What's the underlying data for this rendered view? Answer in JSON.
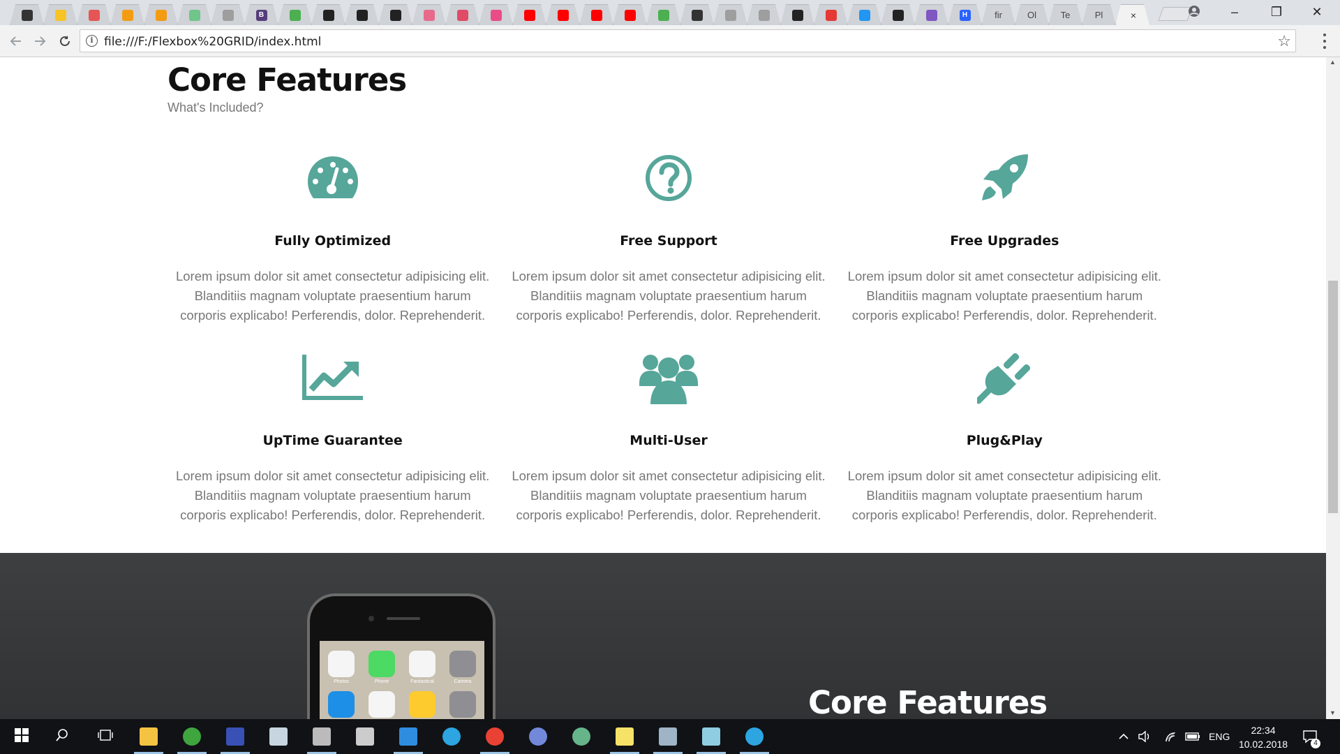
{
  "browser": {
    "tabs": [
      {
        "icon": "codepen-icon",
        "color": "#333333",
        "glyph": ""
      },
      {
        "icon": "sketch-icon",
        "color": "#f7c325",
        "glyph": ""
      },
      {
        "icon": "swirl-icon",
        "color": "#e65555",
        "glyph": ""
      },
      {
        "icon": "asterisk-icon",
        "color": "#f39c12",
        "glyph": ""
      },
      {
        "icon": "asterisk-icon",
        "color": "#f39c12",
        "glyph": ""
      },
      {
        "icon": "hexagon-icon",
        "color": "#6fc58a",
        "glyph": ""
      },
      {
        "icon": "page-icon",
        "color": "#9e9e9e",
        "glyph": ""
      },
      {
        "icon": "bootstrap-icon",
        "color": "#563d7c",
        "glyph": "B"
      },
      {
        "icon": "shield-icon",
        "color": "#4caf50",
        "glyph": ""
      },
      {
        "icon": "camera-icon",
        "color": "#222222",
        "glyph": ""
      },
      {
        "icon": "flag-icon",
        "color": "#222222",
        "glyph": ""
      },
      {
        "icon": "github-icon",
        "color": "#222222",
        "glyph": ""
      },
      {
        "icon": "script-icon",
        "color": "#e76a8a",
        "glyph": ""
      },
      {
        "icon": "u-logo-icon",
        "color": "#e04c66",
        "glyph": ""
      },
      {
        "icon": "dribbble-icon",
        "color": "#ea4c89",
        "glyph": ""
      },
      {
        "icon": "youtube-icon",
        "color": "#ff0000",
        "glyph": ""
      },
      {
        "icon": "youtube-icon",
        "color": "#ff0000",
        "glyph": ""
      },
      {
        "icon": "youtube-icon",
        "color": "#ff0000",
        "glyph": ""
      },
      {
        "icon": "youtube-icon",
        "color": "#ff0000",
        "glyph": ""
      },
      {
        "icon": "w3-icon",
        "color": "#4caf50",
        "glyph": ""
      },
      {
        "icon": "face-icon",
        "color": "#333333",
        "glyph": ""
      },
      {
        "icon": "page-icon",
        "color": "#9e9e9e",
        "glyph": ""
      },
      {
        "icon": "page-icon",
        "color": "#9e9e9e",
        "glyph": ""
      },
      {
        "icon": "github-icon",
        "color": "#222222",
        "glyph": ""
      },
      {
        "icon": "rss-icon",
        "color": "#e53935",
        "glyph": ""
      },
      {
        "icon": "mail-icon",
        "color": "#2196f3",
        "glyph": ""
      },
      {
        "icon": "slash-icon",
        "color": "#222222",
        "glyph": ""
      },
      {
        "icon": "colors-icon",
        "color": "#7e57c2",
        "glyph": ""
      },
      {
        "icon": "h-logo-icon",
        "color": "#2962ff",
        "glyph": "H"
      },
      {
        "icon": "text-tab-icon",
        "color": "",
        "glyph": "fir"
      },
      {
        "icon": "text-tab-icon",
        "color": "",
        "glyph": "Ol"
      },
      {
        "icon": "text-tab-icon",
        "color": "",
        "glyph": "Te"
      },
      {
        "icon": "text-tab-icon",
        "color": "",
        "glyph": "Pl"
      }
    ],
    "active_tab_close": "×",
    "window_buttons": {
      "minimize": "–",
      "restore": "❐",
      "close": "✕"
    },
    "url": "file:///F:/Flexbox%20GRID/index.html",
    "info_glyph": "i",
    "star_glyph": "☆"
  },
  "page": {
    "title": "Core Features",
    "subtitle": "What's Included?",
    "accent_color": "#56a69a",
    "features": [
      {
        "icon": "dashboard-icon",
        "title": "Fully Optimized",
        "text": "Lorem ipsum dolor sit amet consectetur adipisicing elit. Blanditiis magnam voluptate praesentium harum corporis explicabo! Perferendis, dolor. Reprehenderit."
      },
      {
        "icon": "question-circle-icon",
        "title": "Free Support",
        "text": "Lorem ipsum dolor sit amet consectetur adipisicing elit. Blanditiis magnam voluptate praesentium harum corporis explicabo! Perferendis, dolor. Reprehenderit."
      },
      {
        "icon": "rocket-icon",
        "title": "Free Upgrades",
        "text": "Lorem ipsum dolor sit amet consectetur adipisicing elit. Blanditiis magnam voluptate praesentium harum corporis explicabo! Perferendis, dolor. Reprehenderit."
      },
      {
        "icon": "line-chart-icon",
        "title": "UpTime Guarantee",
        "text": "Lorem ipsum dolor sit amet consectetur adipisicing elit. Blanditiis magnam voluptate praesentium harum corporis explicabo! Perferendis, dolor. Reprehenderit."
      },
      {
        "icon": "users-icon",
        "title": "Multi-User",
        "text": "Lorem ipsum dolor sit amet consectetur adipisicing elit. Blanditiis magnam voluptate praesentium harum corporis explicabo! Perferendis, dolor. Reprehenderit."
      },
      {
        "icon": "plug-icon",
        "title": "Plug&Play",
        "text": "Lorem ipsum dolor sit amet consectetur adipisicing elit. Blanditiis magnam voluptate praesentium harum corporis explicabo! Perferendis, dolor. Reprehenderit."
      }
    ],
    "dark_section": {
      "title": "Core Features",
      "phone_apps": [
        {
          "label": "Photos",
          "color": "#f5f5f5"
        },
        {
          "label": "Phone",
          "color": "#4cd964"
        },
        {
          "label": "Fantastical",
          "color": "#f5f5f5"
        },
        {
          "label": "Camera",
          "color": "#8e8e93"
        },
        {
          "label": "",
          "color": "#1d8fe6"
        },
        {
          "label": "",
          "color": "#f5f5f5"
        },
        {
          "label": "",
          "color": "#fecb2f"
        },
        {
          "label": "",
          "color": "#8e8e93"
        }
      ]
    }
  },
  "taskbar": {
    "apps": [
      {
        "icon": "windows-start-icon",
        "open": false
      },
      {
        "icon": "search-icon",
        "open": false
      },
      {
        "icon": "task-view-icon",
        "open": false
      },
      {
        "icon": "file-explorer-icon",
        "open": true
      },
      {
        "icon": "utorrent-icon",
        "open": true
      },
      {
        "icon": "floppy-save-icon",
        "open": true
      },
      {
        "icon": "steam-icon",
        "open": false
      },
      {
        "icon": "inkscape-icon",
        "open": true
      },
      {
        "icon": "eye-app-icon",
        "open": false
      },
      {
        "icon": "vscode-icon",
        "open": true
      },
      {
        "icon": "telegram-icon",
        "open": false
      },
      {
        "icon": "chrome-icon",
        "open": true
      },
      {
        "icon": "discord-icon",
        "open": false
      },
      {
        "icon": "atom-icon",
        "open": false
      },
      {
        "icon": "sticky-notes-icon",
        "open": true
      },
      {
        "icon": "network-monitor-icon",
        "open": true
      },
      {
        "icon": "notepad-icon",
        "open": true
      },
      {
        "icon": "telegram-icon",
        "open": true
      }
    ],
    "tray": {
      "language": "ENG",
      "time": "22:34",
      "date": "10.02.2018",
      "notifications": "4"
    }
  }
}
